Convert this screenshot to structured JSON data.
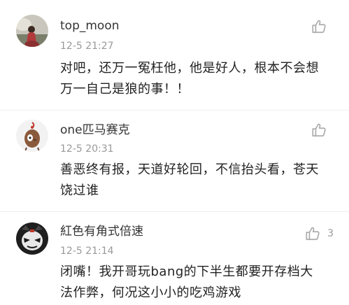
{
  "comments": [
    {
      "username": "top_moon",
      "timestamp": "12-5 21:27",
      "body_lines": [
        "对吧，还万一冤枉他，他是好人，根本不会想",
        "万一自己是狼的事！！"
      ],
      "likes": "",
      "avatar_icon": "avatar-photo-person"
    },
    {
      "username": "one匹马赛克",
      "timestamp": "12-5 20:31",
      "body_lines": [
        "善恶终有报，天道好轮回，不信抬头看，苍天",
        "饶过谁"
      ],
      "likes": "",
      "avatar_icon": "avatar-cartoon-creature"
    },
    {
      "username": "紅色有角式倍速",
      "timestamp": "12-5 21:14",
      "body_lines": [
        "闭嘴！我开哥玩bang的下半生都要开存档大",
        "法作弊，何况这小小的吃鸡游戏"
      ],
      "likes": "3",
      "avatar_icon": "avatar-masked-character"
    }
  ],
  "icons": {
    "like": "thumbs-up-icon"
  },
  "colors": {
    "username": "#333333",
    "timestamp": "#999999",
    "body": "#222222",
    "icon": "#aaaaaa"
  }
}
